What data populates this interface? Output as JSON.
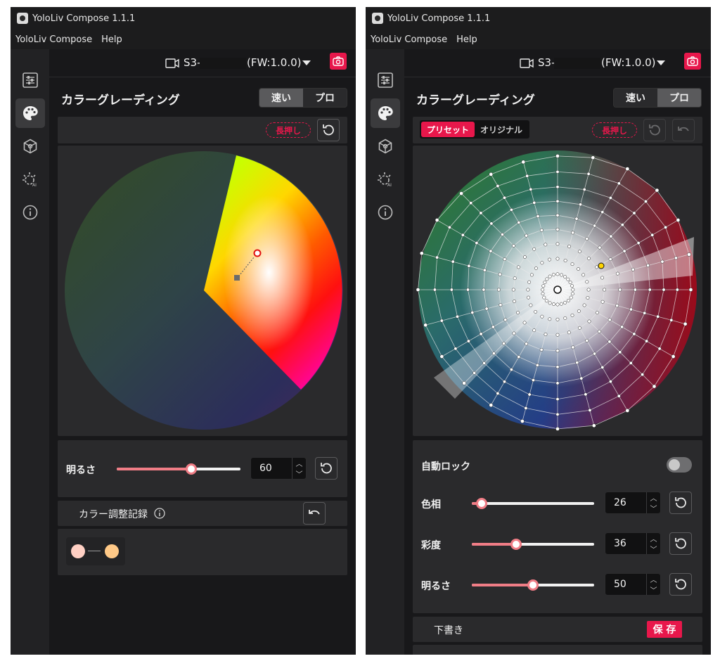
{
  "app": {
    "title": "YoloLiv Compose  1.1.1",
    "menus": [
      "YoloLiv Compose",
      "Help"
    ]
  },
  "device": {
    "name": "S3-",
    "firmware": "(FW:1.0.0)"
  },
  "section_title": "カラーグレーディング",
  "modes": {
    "fast": "速い",
    "pro": "プロ"
  },
  "long_press": "長押し",
  "brand_color": "#e8174b",
  "left": {
    "active_mode": "fast",
    "brightness_label": "明るさ",
    "brightness_value": "60",
    "brightness_level": 0.6,
    "history_label": "カラー調整記録",
    "history_swatches": [
      "#ffd0c4",
      "#ffc987"
    ]
  },
  "right": {
    "active_mode": "pro",
    "preset_tabs": [
      "プリセット",
      "オリジナル"
    ],
    "auto_lock_label": "自動ロック",
    "hue_label": "色相",
    "hue_value": "26",
    "hue_level": 0.08,
    "saturation_label": "彩度",
    "saturation_value": "36",
    "saturation_level": 0.36,
    "brightness_label": "明るさ",
    "brightness_value": "50",
    "brightness_level": 0.5,
    "draft_label": "下書き",
    "save_label": "保 存"
  }
}
